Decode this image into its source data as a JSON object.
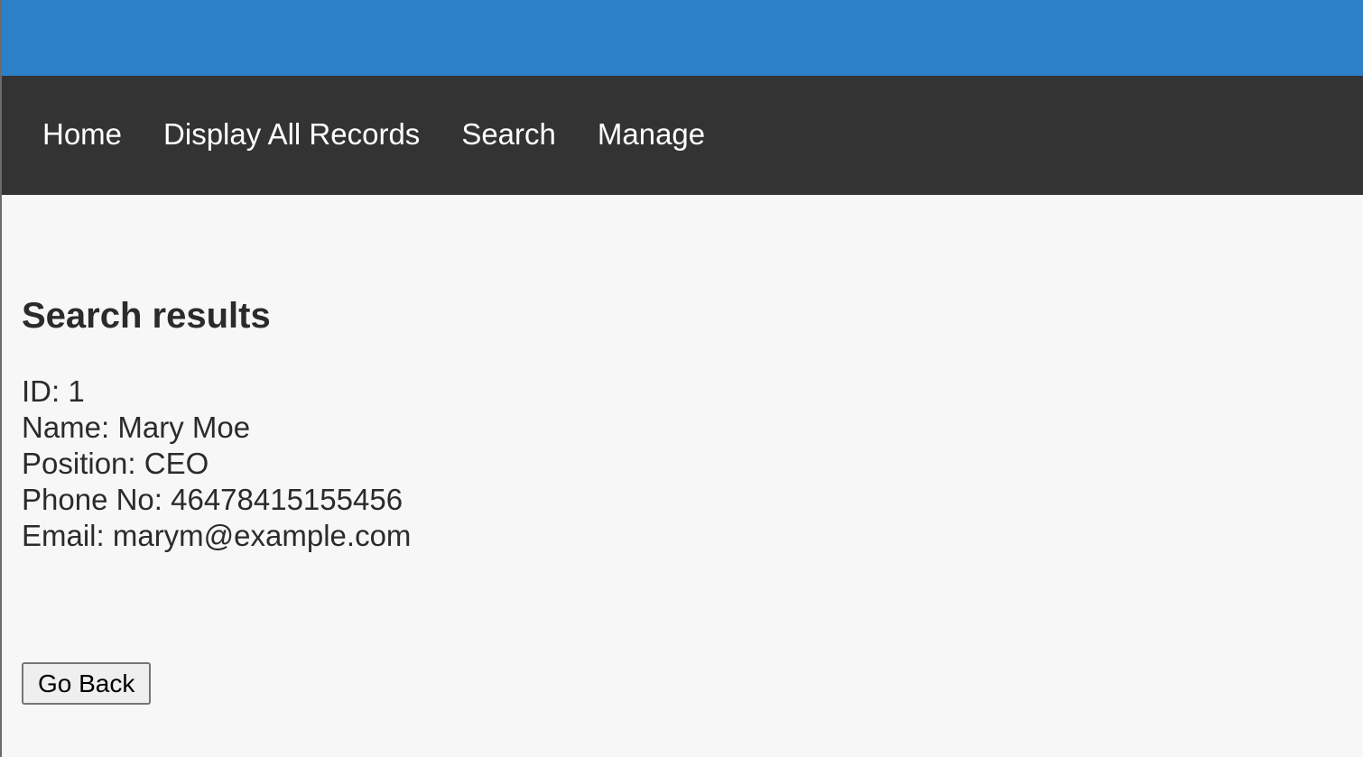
{
  "nav": {
    "items": [
      {
        "label": "Home"
      },
      {
        "label": "Display All Records"
      },
      {
        "label": "Search"
      },
      {
        "label": "Manage"
      }
    ]
  },
  "main": {
    "title": "Search results",
    "record": {
      "id": "ID: 1",
      "name": "Name: Mary Moe",
      "position": "Position: CEO",
      "phone": "Phone No: 46478415155456",
      "email": "Email: marym@example.com"
    },
    "back_label": "Go Back"
  },
  "colors": {
    "banner": "#2c80c8",
    "nav_background": "#333333",
    "page_background": "#f7f7f7"
  }
}
